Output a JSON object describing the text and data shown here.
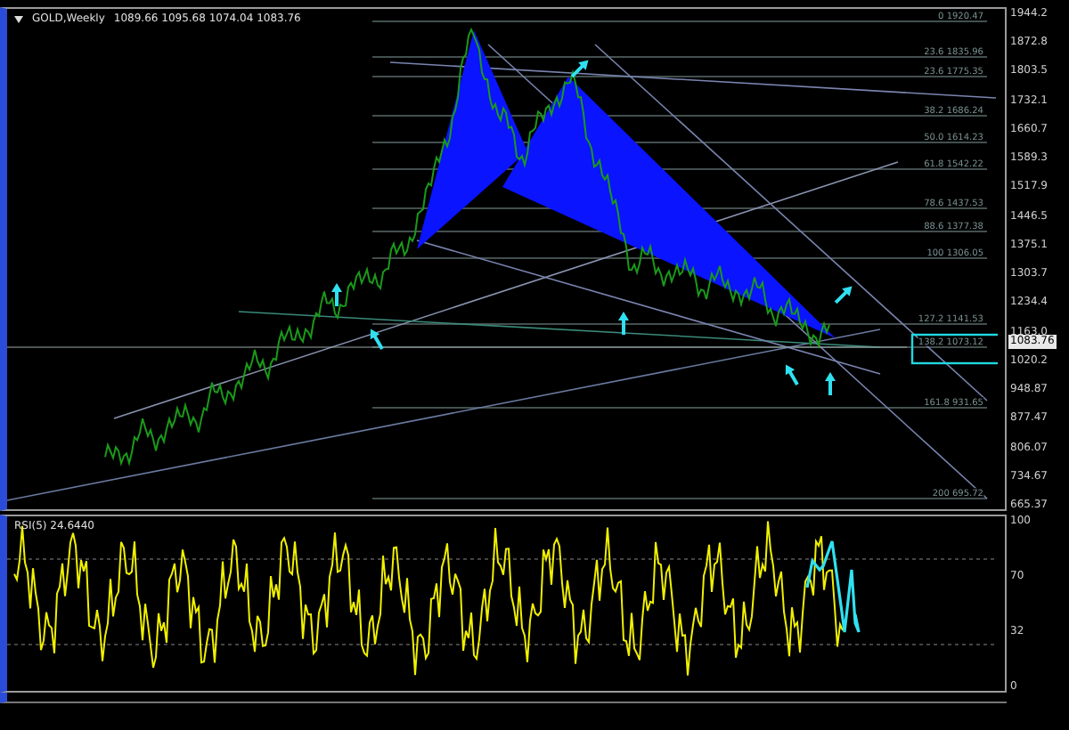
{
  "chart": {
    "symbol": "GOLD,Weekly",
    "ohlc": "1089.66 1095.68 1074.04 1083.76",
    "price_axis": [
      "1944.2",
      "1872.8",
      "1803.5",
      "1732.1",
      "1660.7",
      "1589.3",
      "1517.9",
      "1446.5",
      "1375.1",
      "1303.7",
      "1234.4",
      "1163.0",
      "1020.2",
      "948.87",
      "877.47",
      "806.07",
      "734.67",
      "665.37"
    ],
    "current_price": "1083.76",
    "fib_levels": [
      {
        "label": "0 1920.47"
      },
      {
        "label": "23.6 1835.96"
      },
      {
        "label": "23.6 1775.35"
      },
      {
        "label": "38.2 1686.24"
      },
      {
        "label": "50.0 1614.23"
      },
      {
        "label": "61.8 1542.22"
      },
      {
        "label": "78.6 1437.53"
      },
      {
        "label": "88.6 1377.38"
      },
      {
        "label": "100 1306.05"
      },
      {
        "label": "127.2 1141.53"
      },
      {
        "label": "138.2 1073.12"
      },
      {
        "label": "161.8 931.65"
      },
      {
        "label": "200 695.72"
      }
    ]
  },
  "rsi": {
    "label": "RSI(5) 24.6440",
    "axis": [
      "100",
      "70",
      "32",
      "0"
    ]
  }
}
